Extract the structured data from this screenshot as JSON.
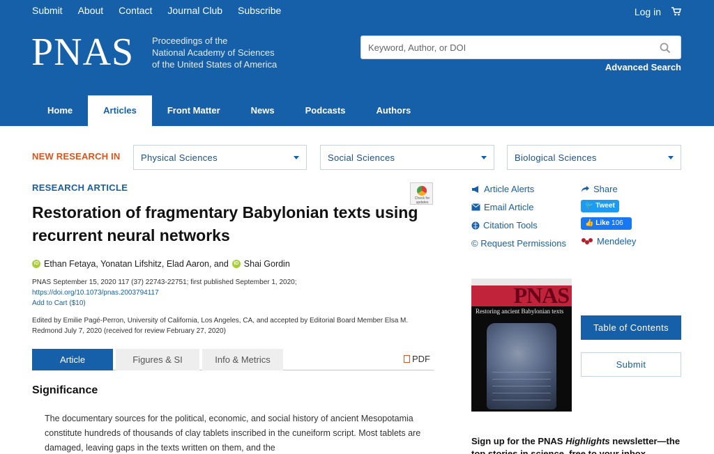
{
  "header": {
    "top_links": [
      "Submit",
      "About",
      "Contact",
      "Journal Club",
      "Subscribe"
    ],
    "login": "Log in",
    "logo": "PNAS",
    "tagline_lines": [
      "Proceedings of the",
      "National Academy of Sciences",
      "of the United States of America"
    ],
    "search_placeholder": "Keyword, Author, or DOI",
    "advanced_search": "Advanced Search",
    "nav": [
      "Home",
      "Articles",
      "Front Matter",
      "News",
      "Podcasts",
      "Authors"
    ],
    "active_nav": "Articles"
  },
  "research": {
    "label": "NEW RESEARCH IN",
    "selects": [
      "Physical Sciences",
      "Social Sciences",
      "Biological Sciences"
    ]
  },
  "article": {
    "type": "RESEARCH ARTICLE",
    "check_updates": "Check for updates",
    "title": "Restoration of fragmentary Babylonian texts using recurrent neural networks",
    "authors_a": "Ethan Fetaya, Yonatan Lifshitz, Elad Aaron, and",
    "authors_b": "Shai Gordin",
    "citation": "PNAS September 15, 2020 117 (37) 22743-22751; first published September 1, 2020;",
    "doi": "https://doi.org/10.1073/pnas.2003794117",
    "cart": "Add to Cart ($10)",
    "edited": "Edited by Emilie Pagé-Perron, University of California, Los Angeles, CA, and accepted by Editorial Board Member Elsa M. Redmond July 7, 2020 (received for review February 27, 2020)",
    "tabs": [
      "Article",
      "Figures & SI",
      "Info & Metrics"
    ],
    "pdf": "PDF",
    "section": "Significance",
    "section_text": "The documentary sources for the political, economic, and social history of ancient Mesopotamia constitute hundreds of thousands of clay tablets inscribed in the cuneiform script. Most tablets are damaged, leaving gaps in the texts written on them, and the"
  },
  "sidebar": {
    "tools": [
      "Article Alerts",
      "Email Article",
      "Citation Tools",
      "© Request Permissions"
    ],
    "share": "Share",
    "tweet": "Tweet",
    "like": "Like",
    "like_count": "106",
    "mendeley": "Mendeley",
    "cover_logo": "PNAS",
    "cover_text": "Restoring ancient Babylonian texts",
    "toc": "Table of Contents",
    "submit": "Submit",
    "signup_a": "Sign up for the PNAS",
    "signup_em": "Highlights",
    "signup_b": "newsletter—the top stories in science, free to your inbox"
  }
}
